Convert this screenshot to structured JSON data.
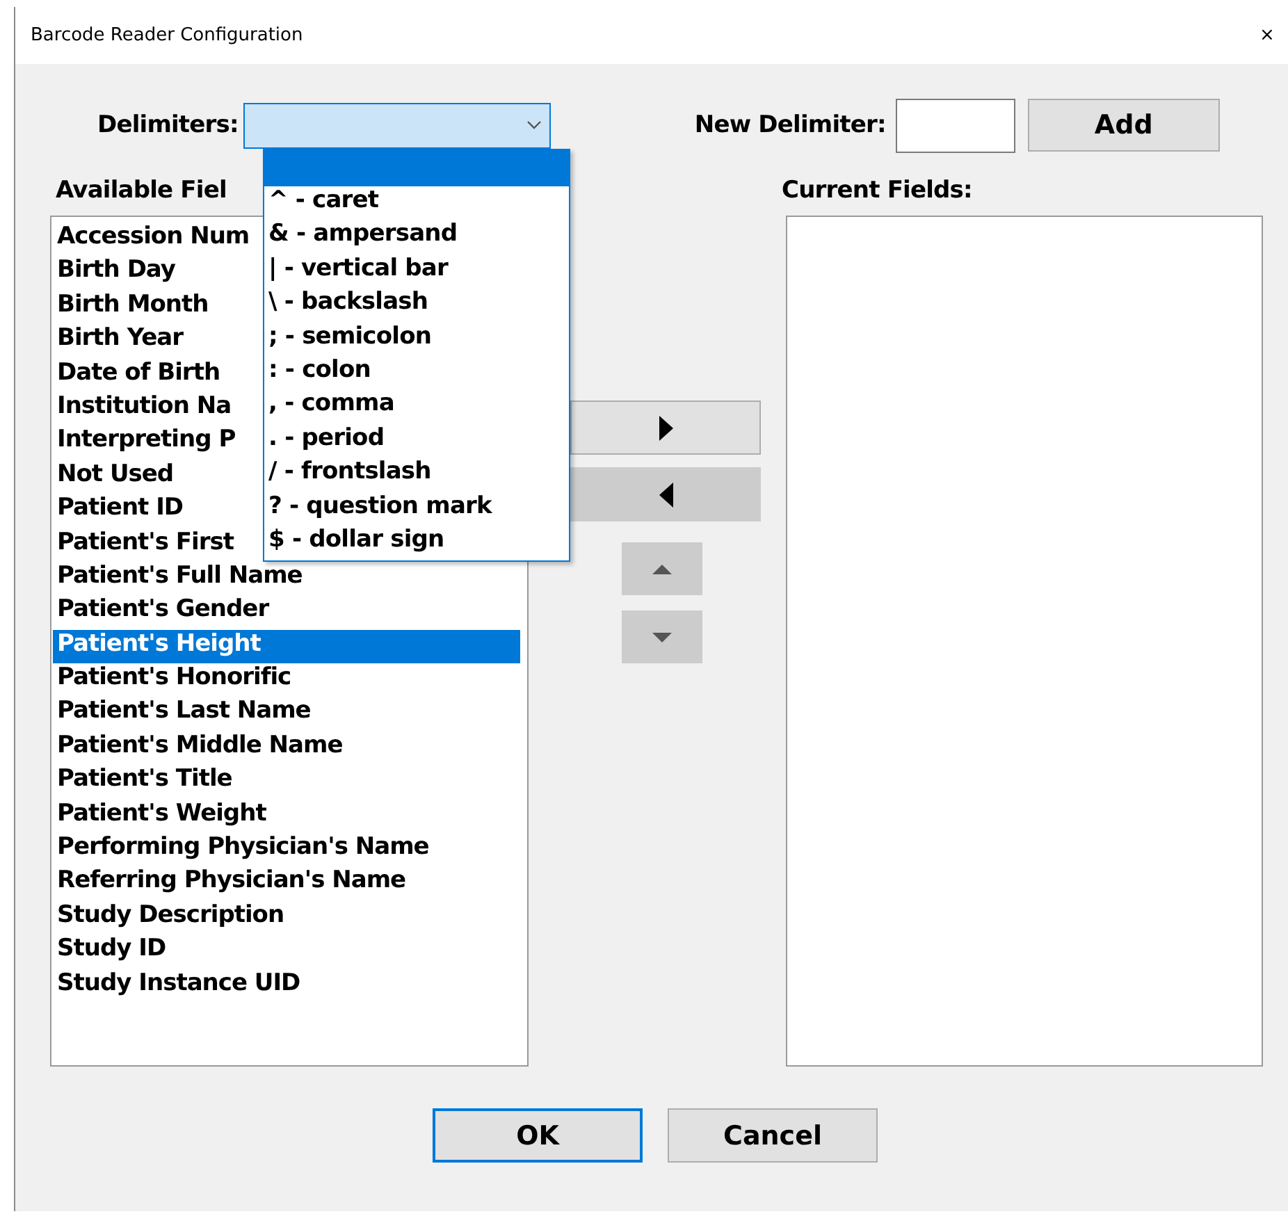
{
  "window": {
    "title": "Barcode Reader Configuration",
    "close_glyph": "×"
  },
  "delimiters": {
    "label": "Delimiters:",
    "open": true,
    "blank_option_highlighted": true,
    "options": [
      {
        "label": "^ - caret"
      },
      {
        "label": "& - ampersand"
      },
      {
        "label": "| - vertical bar"
      },
      {
        "label": "\\ - backslash"
      },
      {
        "label": "; - semicolon"
      },
      {
        "label": ": - colon"
      },
      {
        "label": ", - comma"
      },
      {
        "label": ". - period"
      },
      {
        "label": "/ - frontslash"
      },
      {
        "label": "? - question mark"
      },
      {
        "label": "$ - dollar sign"
      }
    ]
  },
  "new_delimiter": {
    "label": "New Delimiter:",
    "button": "Add"
  },
  "available_fields": {
    "label": "Available Fiel",
    "items": [
      {
        "label": "Accession Num",
        "selected": false
      },
      {
        "label": "Birth Day",
        "selected": false
      },
      {
        "label": "Birth Month",
        "selected": false
      },
      {
        "label": "Birth Year",
        "selected": false
      },
      {
        "label": "Date of Birth",
        "selected": false
      },
      {
        "label": "Institution Na",
        "selected": false
      },
      {
        "label": "Interpreting P",
        "selected": false
      },
      {
        "label": "Not Used",
        "selected": false
      },
      {
        "label": "Patient ID",
        "selected": false
      },
      {
        "label": "Patient's First",
        "selected": false
      },
      {
        "label": "Patient's Full Name",
        "selected": false
      },
      {
        "label": "Patient's Gender",
        "selected": false
      },
      {
        "label": "Patient's Height",
        "selected": true
      },
      {
        "label": "Patient's Honorific",
        "selected": false
      },
      {
        "label": "Patient's Last Name",
        "selected": false
      },
      {
        "label": "Patient's Middle Name",
        "selected": false
      },
      {
        "label": "Patient's Title",
        "selected": false
      },
      {
        "label": "Patient's Weight",
        "selected": false
      },
      {
        "label": "Performing Physician's Name",
        "selected": false
      },
      {
        "label": "Referring Physician's Name",
        "selected": false
      },
      {
        "label": "Study Description",
        "selected": false
      },
      {
        "label": "Study ID",
        "selected": false
      },
      {
        "label": "Study Instance UID",
        "selected": false
      }
    ]
  },
  "move_buttons": [
    {
      "kind": "add",
      "hover": false
    },
    {
      "kind": "remove",
      "hover": true
    }
  ],
  "order_buttons": [
    {
      "kind": "up"
    },
    {
      "kind": "down"
    }
  ],
  "current_fields": {
    "label": "Current Fields:"
  },
  "buttons": [
    {
      "label": "OK",
      "default": true
    },
    {
      "label": "Cancel",
      "default": false
    }
  ]
}
